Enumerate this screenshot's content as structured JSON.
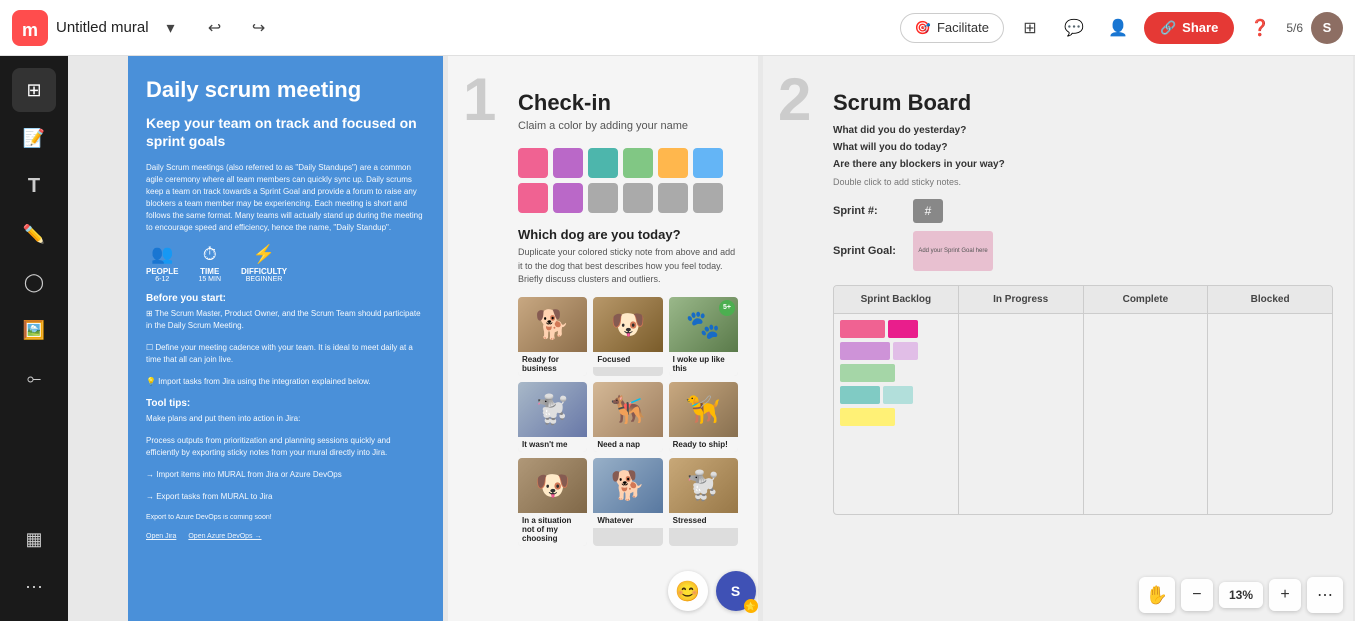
{
  "topbar": {
    "title": "Untitled mural",
    "undo_label": "↩",
    "redo_label": "↪",
    "facilitate_label": "Facilitate",
    "share_label": "Share",
    "viewer_count": "5/6",
    "avatar_initial": "S"
  },
  "sidebar": {
    "items": [
      {
        "id": "frames",
        "icon": "⊞",
        "label": "Frames"
      },
      {
        "id": "sticky",
        "icon": "🗒",
        "label": "Sticky"
      },
      {
        "id": "text",
        "icon": "T",
        "label": "Text"
      },
      {
        "id": "draw",
        "icon": "✏",
        "label": "Draw"
      },
      {
        "id": "shapes",
        "icon": "◯",
        "label": "Shapes"
      },
      {
        "id": "images",
        "icon": "🖼",
        "label": "Images"
      },
      {
        "id": "connect",
        "icon": "⟜",
        "label": "Connect"
      },
      {
        "id": "table",
        "icon": "⊞",
        "label": "Table"
      },
      {
        "id": "more",
        "icon": "⋯",
        "label": "More"
      }
    ]
  },
  "panel_blue": {
    "title": "Daily scrum meeting",
    "subtitle": "Keep your team on track and focused on sprint goals",
    "description": "Daily Scrum meetings (also referred to as \"Daily Standups\") are a common agile ceremony where all team members can quickly sync up. Daily scrums keep a team on track towards a Sprint Goal and provide a forum to raise any blockers a team member may be experiencing. Each meeting is short and follows the same format. Many teams will actually stand up during the meeting to encourage speed and efficiency, hence the name, \"Daily Standup\".",
    "stats": [
      {
        "icon": "👥",
        "label": "PEOPLE",
        "value": "6-12"
      },
      {
        "icon": "⏱",
        "label": "TIME",
        "value": "15 MIN"
      },
      {
        "icon": "⚡",
        "label": "DIFFICULTY",
        "value": "BEGINNER"
      }
    ],
    "before_start_title": "Before you start:",
    "before_start_items": [
      "The Scrum Master, Product Owner, and the Scrum Team should participate in the Daily Scrum Meeting.",
      "Define your meeting cadence with your team. It is ideal to meet daily at a time that all can join live.",
      "Import tasks from Jira using the integration explained below."
    ],
    "tool_tips_title": "Tool tips:",
    "tool_tip_text": "Make plans and put them into action in Jira: Process outputs from prioritization and planning sessions quickly and efficiently by exporting sticky notes from your mural directly into Jira.",
    "import_label": "Import items into MURAL from Jira or Azure DevOps",
    "export_label": "Export tasks from MURAL to Jira",
    "links": [
      "Open Jira",
      "Open Azure DevOps →"
    ]
  },
  "panel_checkin": {
    "number": "1",
    "title": "Check-in",
    "subtitle": "Claim a color by adding your name",
    "stickies": [
      {
        "color": "#f06292"
      },
      {
        "color": "#ba68c8"
      },
      {
        "color": "#4db6ac"
      },
      {
        "color": "#81c784"
      },
      {
        "color": "#ffb74d"
      },
      {
        "color": "#64b5f6"
      },
      {
        "color": "#f06292"
      },
      {
        "color": "#ba68c8"
      },
      {
        "color": "#aaaaaa"
      },
      {
        "color": "#aaaaaa"
      },
      {
        "color": "#aaaaaa"
      },
      {
        "color": "#aaaaaa"
      }
    ],
    "dog_section_title": "Which dog are you today?",
    "dog_section_desc": "Duplicate your colored sticky note from above and add it to the dog that best describes how you feel today.\nBriefly discuss clusters and outliers.",
    "dogs": [
      {
        "label": "Ready for business",
        "emoji": "🐕",
        "badge": null
      },
      {
        "label": "Focused",
        "emoji": "🐶",
        "badge": null
      },
      {
        "label": "I woke up like this",
        "emoji": "🐾",
        "badge": "5+"
      },
      {
        "label": "It wasn't me",
        "emoji": "🐩",
        "badge": null
      },
      {
        "label": "Need a nap",
        "emoji": "🐕‍🦺",
        "badge": null
      },
      {
        "label": "Ready to ship!",
        "emoji": "🦮",
        "badge": null
      },
      {
        "label": "In a situation not of my choosing",
        "emoji": "🐶",
        "badge": null
      },
      {
        "label": "Whatever",
        "emoji": "🐕",
        "badge": null
      },
      {
        "label": "Stressed",
        "emoji": "🐩",
        "badge": null
      }
    ]
  },
  "panel_scrum": {
    "number": "2",
    "title": "Scrum Board",
    "questions": [
      "What did you do yesterday?",
      "What will you do today?",
      "Are there any blockers in your way?"
    ],
    "meta": "Double click to add sticky notes.",
    "sprint_label": "Sprint #:",
    "sprint_goal_label": "Sprint Goal:",
    "sprint_goal_text": "Add your Sprint Goal here",
    "columns": [
      {
        "header": "Sprint Backlog",
        "color": "#4db6ac"
      },
      {
        "header": "In Progress",
        "color": "#64b5f6"
      },
      {
        "header": "Complete",
        "color": "#81c784"
      },
      {
        "header": "Blocked",
        "color": "#f06292"
      }
    ],
    "board_stickies": [
      [
        {
          "colors": [
            "#f06292",
            "#e91e8c"
          ]
        },
        {
          "colors": [
            "#ce93d8",
            "#e1bee7"
          ]
        },
        {
          "colors": [
            "#a5d6a7"
          ]
        },
        {
          "colors": [
            "#80cbc4",
            "#b2dfdb"
          ]
        },
        {
          "colors": [
            "#fff176"
          ]
        }
      ]
    ]
  },
  "zoom": {
    "level": "13%",
    "minus": "−",
    "plus": "+"
  },
  "emoji_bar": {
    "emoji": "😊",
    "user_initial": "S"
  }
}
